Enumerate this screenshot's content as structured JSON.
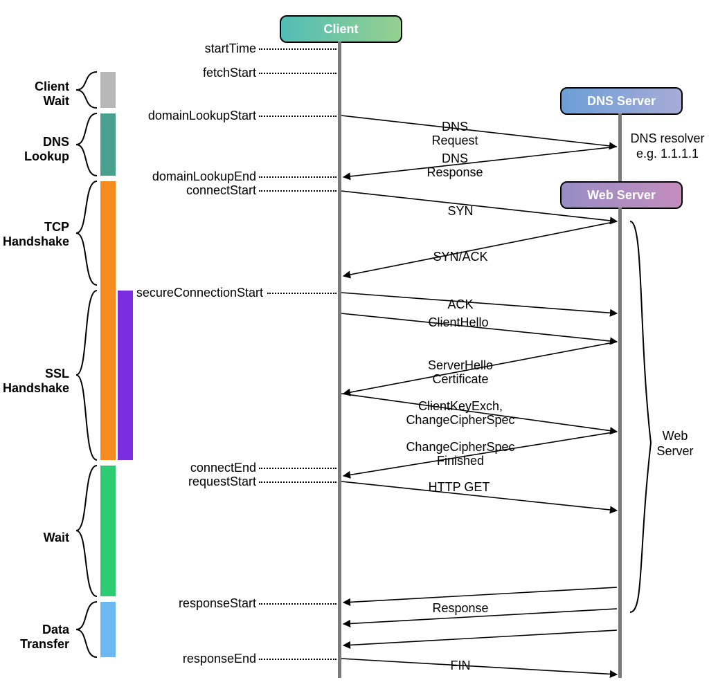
{
  "actors": {
    "client": "Client",
    "dns": "DNS Server",
    "web": "Web Server"
  },
  "phases": {
    "client_wait": "Client\nWait",
    "dns_lookup": "DNS\nLookup",
    "tcp_handshake": "TCP\nHandshake",
    "ssl_handshake": "SSL\nHandshake",
    "wait": "Wait",
    "data_transfer": "Data\nTransfer"
  },
  "timings": {
    "startTime": "startTime",
    "fetchStart": "fetchStart",
    "domainLookupStart": "domainLookupStart",
    "domainLookupEnd": "domainLookupEnd",
    "connectStart": "connectStart",
    "secureConnectionStart": "secureConnectionStart",
    "connectEnd": "connectEnd",
    "requestStart": "requestStart",
    "responseStart": "responseStart",
    "responseEnd": "responseEnd"
  },
  "messages": {
    "dns_request": "DNS\nRequest",
    "dns_response": "DNS\nResponse",
    "syn": "SYN",
    "syn_ack": "SYN/ACK",
    "ack": "ACK",
    "client_hello": "ClientHello",
    "server_hello": "ServerHello\nCertificate",
    "client_key_exch": "ClientKeyExch,\nChangeCipherSpec",
    "change_cipher_finish": "ChangeCipherSpec\nFinished",
    "http_get": "HTTP GET",
    "response": "Response",
    "fin": "FIN"
  },
  "notes": {
    "dns_resolver": "DNS resolver\ne.g. 1.1.1.1",
    "web_server": "Web\nServer"
  },
  "colors": {
    "client_box": [
      "#51bdb6",
      "#95d08e"
    ],
    "dns_box": [
      "#6b9fd7",
      "#a7abd7"
    ],
    "web_box": [
      "#978dc4",
      "#c48dbd"
    ],
    "bar_grey": "#b8b8b8",
    "bar_teal": "#4aa08e",
    "bar_orange": "#f68b1f",
    "bar_purple": "#7a2ee0",
    "bar_green": "#2ecc71",
    "bar_blue": "#6cb9f2"
  }
}
